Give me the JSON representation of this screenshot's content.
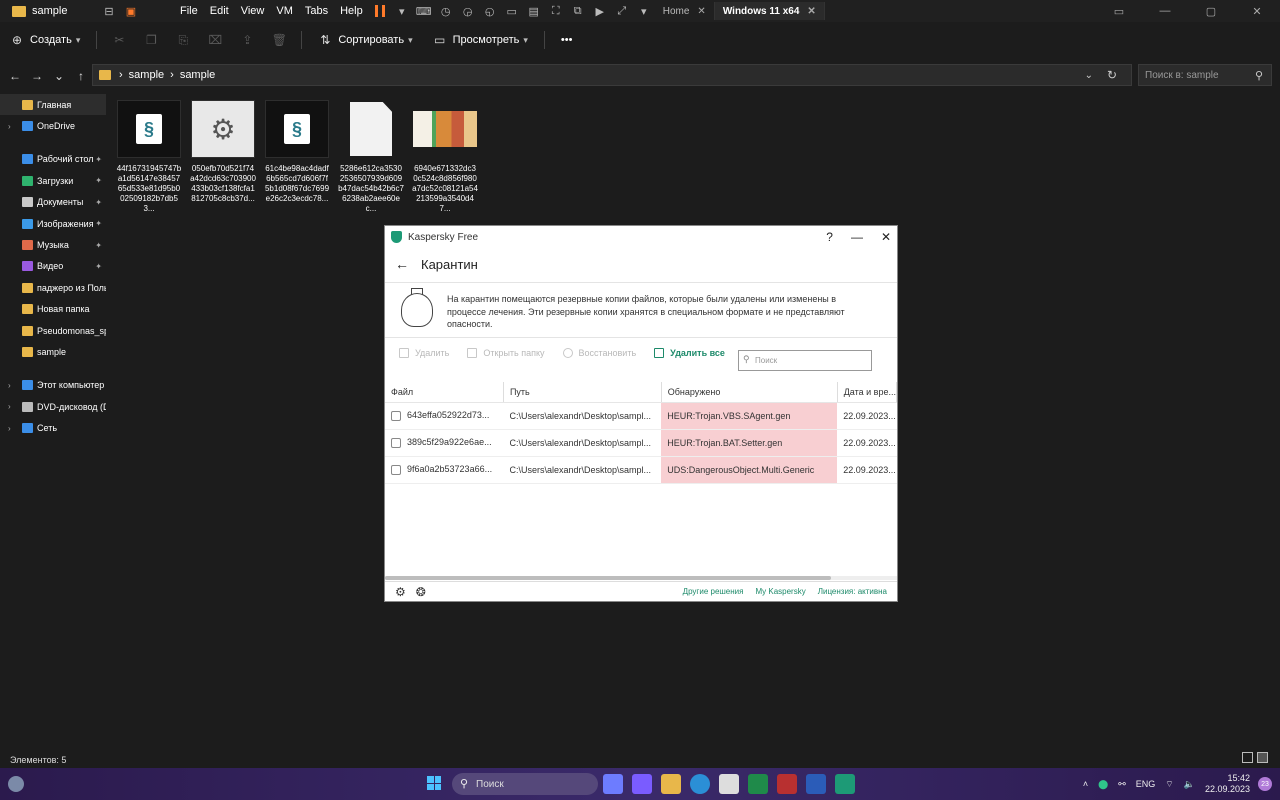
{
  "window": {
    "title": "sample"
  },
  "vm_menu": [
    "File",
    "Edit",
    "View",
    "VM",
    "Tabs",
    "Help"
  ],
  "vm_tabs": [
    {
      "label": "Home",
      "active": false
    },
    {
      "label": "Windows 11 x64",
      "active": true
    }
  ],
  "toolbar": {
    "create_label": "Создать",
    "sort_label": "Сортировать",
    "view_label": "Просмотреть",
    "more_label": "•••"
  },
  "address": {
    "segments": [
      "sample",
      "sample"
    ],
    "search_placeholder": "Поиск в: sample"
  },
  "sidebar": {
    "items": [
      {
        "label": "Главная",
        "icon": "home-icon",
        "color": "#e8b74a",
        "selected": true,
        "arrow": false,
        "pin": false
      },
      {
        "label": "OneDrive",
        "icon": "cloud-icon",
        "color": "#3b8ee8",
        "selected": false,
        "arrow": true,
        "pin": false
      },
      {
        "label": "Рабочий стол",
        "icon": "desktop-icon",
        "color": "#3b8ee8",
        "selected": false,
        "arrow": false,
        "pin": true
      },
      {
        "label": "Загрузки",
        "icon": "download-icon",
        "color": "#2fb36e",
        "selected": false,
        "arrow": false,
        "pin": true
      },
      {
        "label": "Документы",
        "icon": "documents-icon",
        "color": "#c9c9c9",
        "selected": false,
        "arrow": false,
        "pin": true
      },
      {
        "label": "Изображения",
        "icon": "pictures-icon",
        "color": "#3b9ae8",
        "selected": false,
        "arrow": false,
        "pin": true
      },
      {
        "label": "Музыка",
        "icon": "music-icon",
        "color": "#e06a4a",
        "selected": false,
        "arrow": false,
        "pin": true
      },
      {
        "label": "Видео",
        "icon": "video-icon",
        "color": "#9a5ae0",
        "selected": false,
        "arrow": false,
        "pin": true
      },
      {
        "label": "паджеро из Польши",
        "icon": "folder-icon",
        "color": "#e8b74a",
        "selected": false,
        "arrow": false,
        "pin": false
      },
      {
        "label": "Новая папка",
        "icon": "folder-icon",
        "color": "#e8b74a",
        "selected": false,
        "arrow": false,
        "pin": false
      },
      {
        "label": "Pseudomonas_sp",
        "icon": "folder-icon",
        "color": "#e8b74a",
        "selected": false,
        "arrow": false,
        "pin": false
      },
      {
        "label": "sample",
        "icon": "folder-icon",
        "color": "#e8b74a",
        "selected": false,
        "arrow": false,
        "pin": false
      },
      {
        "label": "Этот компьютер",
        "icon": "computer-icon",
        "color": "#3b8ee8",
        "selected": false,
        "arrow": true,
        "pin": false
      },
      {
        "label": "DVD-дисковод (D:)",
        "icon": "dvd-icon",
        "color": "#bbbbbb",
        "selected": false,
        "arrow": true,
        "pin": false
      },
      {
        "label": "Сеть",
        "icon": "network-icon",
        "color": "#3b8ee8",
        "selected": false,
        "arrow": true,
        "pin": false
      }
    ]
  },
  "files": [
    {
      "name": "44f16731945747ba1d56147e3845765d533e81d95b002509182b7db53...",
      "type": "script"
    },
    {
      "name": "050efb70d521f74a42dcd63c703900433b03cf138fcfa1812705c8cb37d...",
      "type": "gear"
    },
    {
      "name": "61c4be98ac4dadf6b565cd7d606f7f5b1d08f67dc7699e26c2c3ecdc78...",
      "type": "script"
    },
    {
      "name": "5286e612ca35302536507939d609b47dac54b42b6c76238ab2aee60ec...",
      "type": "blank"
    },
    {
      "name": "6940e671332dc30c524c8d856f980a7dc52c08121a54213599a3540d47...",
      "type": "img"
    }
  ],
  "kaspersky": {
    "app_title": "Kaspersky Free",
    "help": "?",
    "minimize": "—",
    "close": "✕",
    "page_title": "Карантин",
    "info_text": "На карантин помещаются резервные копии файлов, которые были удалены или изменены в процессе лечения. Эти резервные копии хранятся в специальном формате и не представляют опасности.",
    "actions": {
      "delete": "Удалить",
      "open_folder": "Открыть папку",
      "restore": "Восстановить",
      "delete_all": "Удалить все"
    },
    "search_placeholder": "Поиск",
    "columns": [
      "Файл",
      "Путь",
      "Обнаружено",
      "Дата и вре..."
    ],
    "rows": [
      {
        "file": "643effa052922d73...",
        "path": "C:\\Users\\alexandr\\Desktop\\sampl...",
        "detected": "HEUR:Trojan.VBS.SAgent.gen",
        "date": "22.09.2023..."
      },
      {
        "file": "389c5f29a922e6ae...",
        "path": "C:\\Users\\alexandr\\Desktop\\sampl...",
        "detected": "HEUR:Trojan.BAT.Setter.gen",
        "date": "22.09.2023..."
      },
      {
        "file": "9f6a0a2b53723a66...",
        "path": "C:\\Users\\alexandr\\Desktop\\sampl...",
        "detected": "UDS:DangerousObject.Multi.Generic",
        "date": "22.09.2023..."
      }
    ],
    "footer_links": [
      "Другие решения",
      "My Kaspersky",
      "Лицензия: активна"
    ],
    "accent": "#1d8a6a",
    "detected_bg": "#f8cfd2"
  },
  "status": {
    "items_count": "Элементов: 5"
  },
  "taskbar": {
    "search_label": "Поиск",
    "lang": "ENG",
    "time": "15:42",
    "date": "22.09.2023",
    "notif_count": "23"
  }
}
